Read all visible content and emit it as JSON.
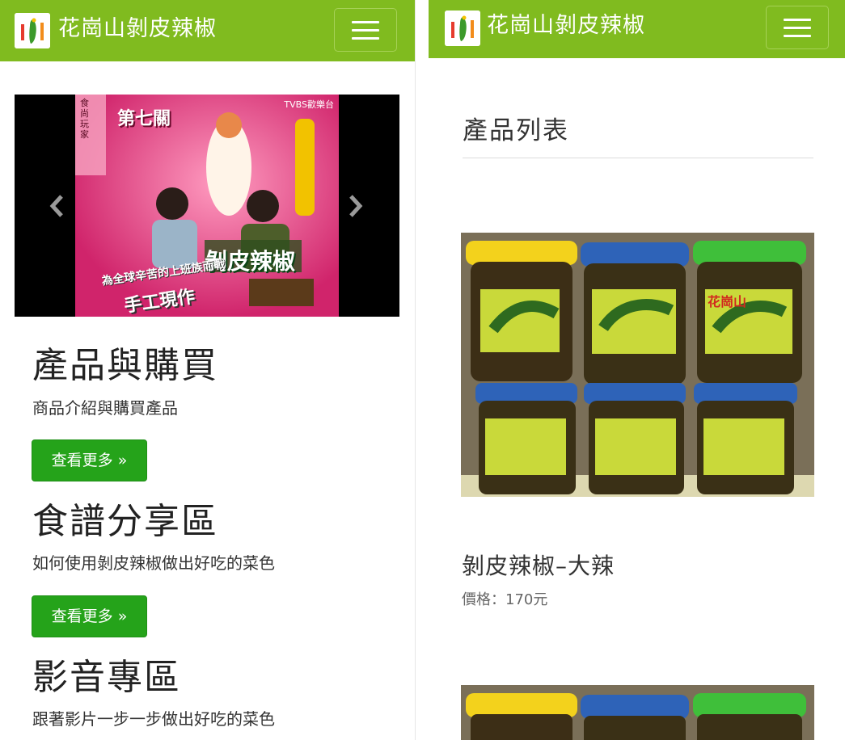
{
  "site": {
    "brand": "花崗山剝皮辣椒",
    "accent": "#80bb1f",
    "button_color": "#25a31a"
  },
  "left": {
    "carousel": {
      "banner_texts": [
        "第七關",
        "剝皮辣椒",
        "為全球辛苦的上班族而戰",
        "手工現作",
        "食尚玩家",
        "TVBS歡樂台"
      ],
      "prev_icon": "chevron-left-icon",
      "next_icon": "chevron-right-icon"
    },
    "sections": [
      {
        "title": "產品與購買",
        "desc": "商品介紹與購買產品",
        "button": "查看更多 »"
      },
      {
        "title": "食譜分享區",
        "desc": "如何使用剝皮辣椒做出好吃的菜色",
        "button": "查看更多 »"
      },
      {
        "title": "影音專區",
        "desc": "跟著影片一步一步做出好吃的菜色"
      }
    ]
  },
  "right": {
    "heading": "產品列表",
    "products": [
      {
        "name": "剝皮辣椒–大辣",
        "price": "價格：170元",
        "jar_label": "花崗山"
      }
    ]
  }
}
